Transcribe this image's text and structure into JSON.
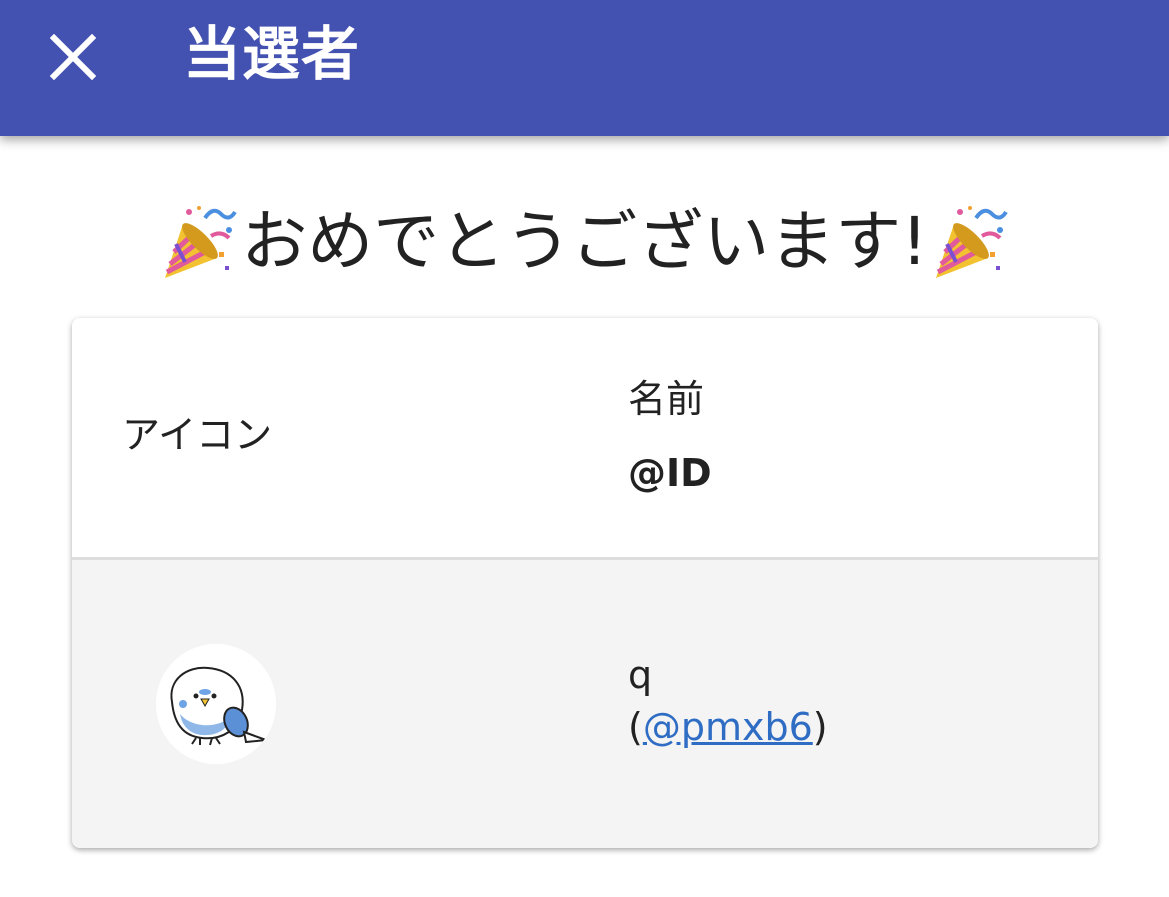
{
  "appbar": {
    "title": "当選者",
    "close_icon": "close-icon",
    "background_color": "#4352b0"
  },
  "heading": {
    "text": "おめでとうございます!",
    "emoji_icon": "party-popper-icon"
  },
  "table": {
    "header": {
      "icon_col": "アイコン",
      "name_col": "名前",
      "id_col": "@ID"
    },
    "rows": [
      {
        "avatar_icon": "parakeet-avatar-icon",
        "name": "q",
        "id_open": "(",
        "id": "@pmxb6",
        "id_close": ")"
      }
    ]
  },
  "colors": {
    "link": "#2f6dc4",
    "row_background": "#f4f4f4"
  }
}
